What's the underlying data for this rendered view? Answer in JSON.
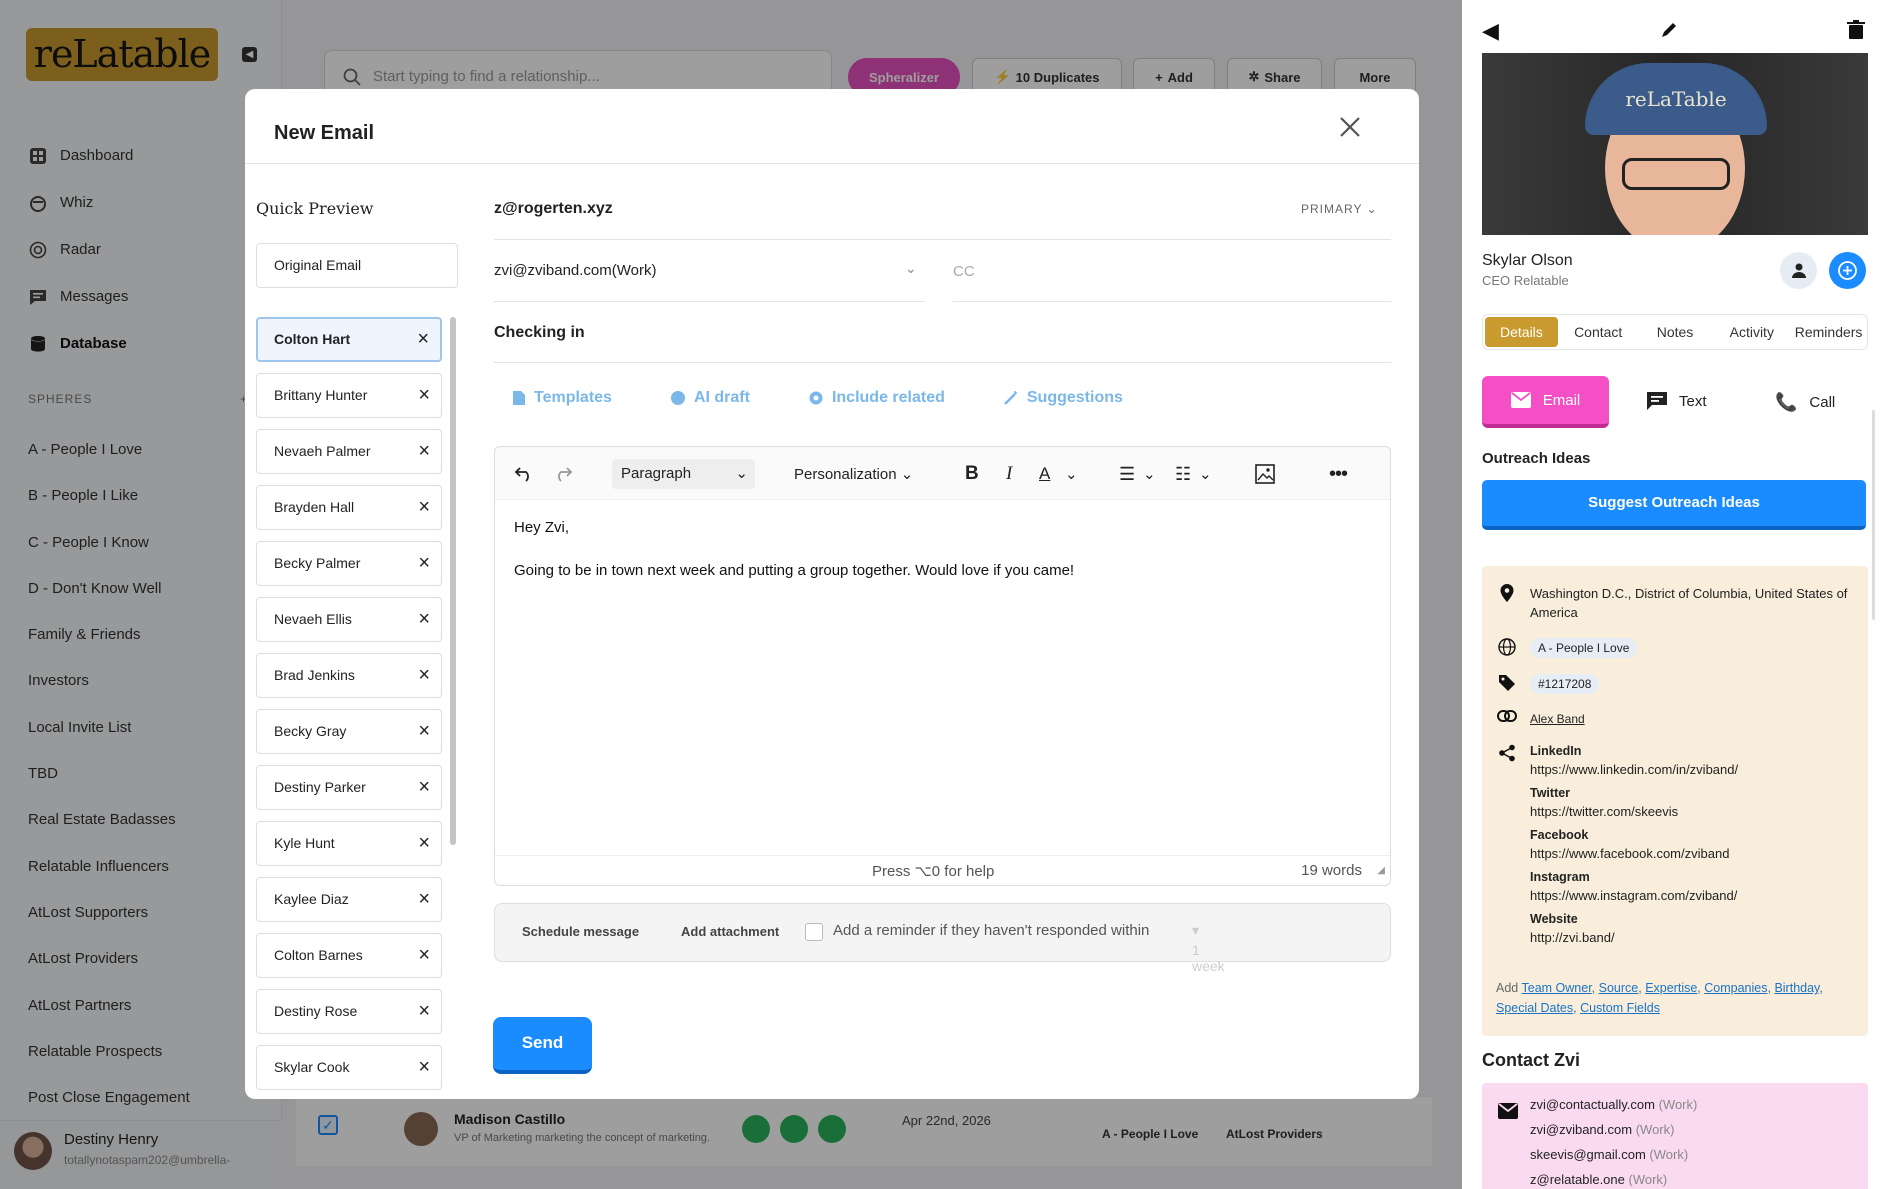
{
  "app": {
    "logo": "reLatable"
  },
  "nav": [
    {
      "label": "Dashboard",
      "icon": "dashboard-icon"
    },
    {
      "label": "Whiz",
      "icon": "whiz-icon"
    },
    {
      "label": "Radar",
      "icon": "radar-icon"
    },
    {
      "label": "Messages",
      "icon": "messages-icon"
    },
    {
      "label": "Database",
      "icon": "database-icon",
      "active": true
    }
  ],
  "spheres": {
    "heading": "SPHERES",
    "add": "+",
    "items": [
      "A - People I Love",
      "B - People I Like",
      "C - People I Know",
      "D - Don't Know Well",
      "Family & Friends",
      "Investors",
      "Local Invite List",
      "TBD",
      "Real Estate Badasses",
      "Relatable Influencers",
      "AtLost Supporters",
      "AtLost Providers",
      "AtLost Partners",
      "Relatable Prospects",
      "Post Close Engagement"
    ]
  },
  "user": {
    "name": "Destiny Henry",
    "email": "totallynotaspam202@umbrella-"
  },
  "topbar": {
    "search_placeholder": "Start typing to find a relationship...",
    "spherealizer": "Spheralizer",
    "duplicates": "10 Duplicates",
    "add": "Add",
    "share": "Share",
    "more": "More"
  },
  "bgrow": {
    "name": "Madison Castillo",
    "title": "VP of Marketing marketing the concept of marketing.",
    "date": "Apr 22nd, 2026",
    "sphere": "A - People I Love",
    "tag": "AtLost Providers"
  },
  "modal": {
    "title": "New Email",
    "quick_preview": "Quick Preview",
    "original": "Original Email",
    "recipients": [
      "Colton Hart",
      "Brittany Hunter",
      "Nevaeh Palmer",
      "Brayden Hall",
      "Becky Palmer",
      "Nevaeh Ellis",
      "Brad Jenkins",
      "Becky Gray",
      "Destiny Parker",
      "Kyle Hunt",
      "Kaylee Diaz",
      "Colton Barnes",
      "Destiny Rose",
      "Skylar Cook"
    ],
    "to": "z@rogerten.xyz",
    "primary": "PRIMARY",
    "from": "zvi@zviband.com(Work)",
    "cc": "CC",
    "subject": "Checking in",
    "tools": {
      "templates": "Templates",
      "ai": "AI draft",
      "related": "Include related",
      "suggestions": "Suggestions"
    },
    "editor": {
      "paragraph": "Paragraph",
      "personalization": "Personalization",
      "greeting": "Hey Zvi,",
      "body": "Going to be in town next week and putting a group together. Would love if you came!",
      "help": "Press ⌥0 for help",
      "words": "19 words"
    },
    "schedule": "Schedule message",
    "attachment": "Add attachment",
    "reminder": "Add a reminder if they haven't responded within",
    "reminder_val": "1 week",
    "send": "Send"
  },
  "profile": {
    "name": "Skylar Olson",
    "title": "CEO Relatable",
    "cap_text": "reLaTable",
    "tabs": [
      "Details",
      "Contact",
      "Notes",
      "Activity",
      "Reminders"
    ],
    "email": "Email",
    "text": "Text",
    "call": "Call",
    "outreach": "Outreach Ideas",
    "suggest": "Suggest Outreach Ideas",
    "location": "Washington D.C., District of Columbia, United States of America",
    "sphere": "A - People I Love",
    "tag": "#1217208",
    "linked": "Alex Band",
    "social": [
      {
        "k": "LinkedIn",
        "v": "https://www.linkedin.com/in/zviband/"
      },
      {
        "k": "Twitter",
        "v": "https://twitter.com/skeevis"
      },
      {
        "k": "Facebook",
        "v": "https://www.facebook.com/zviband"
      },
      {
        "k": "Instagram",
        "v": "https://www.instagram.com/zviband/"
      },
      {
        "k": "Website",
        "v": "http://zvi.band/"
      }
    ],
    "add_label": "Add",
    "add_links": [
      "Team Owner",
      "Source",
      "Expertise",
      "Companies",
      "Birthday",
      "Special Dates",
      "Custom Fields"
    ],
    "contact_title": "Contact Zvi",
    "emails": [
      {
        "e": "zvi@contactually.com",
        "t": "(Work)"
      },
      {
        "e": "zvi@zviband.com",
        "t": "(Work)"
      },
      {
        "e": "skeevis@gmail.com",
        "t": "(Work)"
      },
      {
        "e": "z@relatable.one",
        "t": "(Work)"
      }
    ]
  },
  "colors": {
    "gold": "#c99a2e",
    "blue": "#1a8cff",
    "pink": "#f44fc4"
  }
}
